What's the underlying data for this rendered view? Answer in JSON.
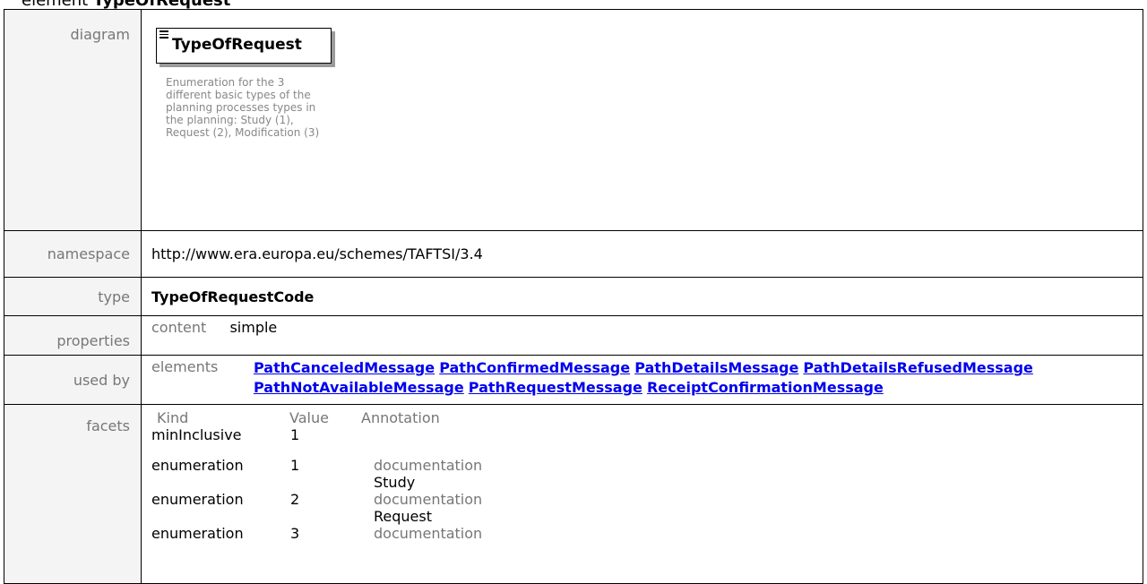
{
  "heading": {
    "prefix": "element ",
    "name": "TypeOfRequest"
  },
  "diagram": {
    "label": "diagram",
    "element_name": "TypeOfRequest",
    "doc_lines": [
      "Enumeration for the 3",
      "different basic types of the",
      "planning processes types in",
      "the planning: Study (1),",
      "Request (2), Modification (3)"
    ]
  },
  "namespace": {
    "label": "namespace",
    "value": "http://www.era.europa.eu/schemes/TAFTSI/3.4"
  },
  "type": {
    "label": "type",
    "value": "TypeOfRequestCode"
  },
  "properties": {
    "label": "properties",
    "key": "content",
    "value": "simple"
  },
  "used_by": {
    "label": "used by",
    "key": "elements",
    "links": [
      "PathCanceledMessage",
      "PathConfirmedMessage",
      "PathDetailsMessage",
      "PathDetailsRefusedMessage",
      "PathNotAvailableMessage",
      "PathRequestMessage",
      "ReceiptConfirmationMessage"
    ]
  },
  "facets": {
    "label": "facets",
    "headers": [
      "Kind",
      "Value",
      "Annotation"
    ],
    "doc_label": "documentation",
    "rows": [
      {
        "kind": "minInclusive",
        "value": "1",
        "doc": ""
      },
      {
        "kind": "enumeration",
        "value": "1",
        "doc": "Study"
      },
      {
        "kind": "enumeration",
        "value": "2",
        "doc": "Request"
      },
      {
        "kind": "enumeration",
        "value": "3",
        "doc": ""
      }
    ]
  }
}
